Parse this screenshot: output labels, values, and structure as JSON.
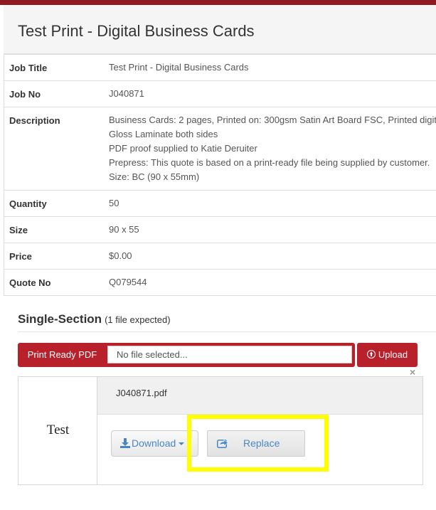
{
  "header": {
    "title": "Test Print - Digital Business Cards"
  },
  "details": {
    "job_title": {
      "label": "Job Title",
      "value": "Test Print - Digital Business Cards"
    },
    "job_no": {
      "label": "Job No",
      "value": "J040871"
    },
    "description": {
      "label": "Description",
      "lines": [
        "Business Cards: 2 pages, Printed on: 300gsm Satin Art Board FSC, Printed digit",
        "Gloss Laminate both sides",
        "PDF proof supplied to Katie Deruiter",
        "Prepress: This quote is based on a print-ready file being supplied by customer.",
        "Size: BC (90 x 55mm)"
      ]
    },
    "quantity": {
      "label": "Quantity",
      "value": "50"
    },
    "size": {
      "label": "Size",
      "value": "90 x 55"
    },
    "price": {
      "label": "Price",
      "value": "$0.00"
    },
    "quote_no": {
      "label": "Quote No",
      "value": "Q079544"
    }
  },
  "section": {
    "title": "Single-Section",
    "note": "(1 file expected)"
  },
  "upload": {
    "file_label": "Print Ready PDF",
    "file_input_text": "No file selected...",
    "upload_label": "Upload",
    "close_symbol": "×"
  },
  "file": {
    "thumbnail_text": "Test",
    "name": "J040871.pdf",
    "download_label": "Download",
    "replace_label": "Replace"
  },
  "colors": {
    "brand_red": "#b8202b",
    "top_bar": "#8e1b24",
    "link_blue": "#4a86c5",
    "highlight": "#ffff00"
  },
  "icons": {
    "upload": "upload-icon",
    "download": "download-icon",
    "replace": "share-icon",
    "close": "close-icon"
  }
}
